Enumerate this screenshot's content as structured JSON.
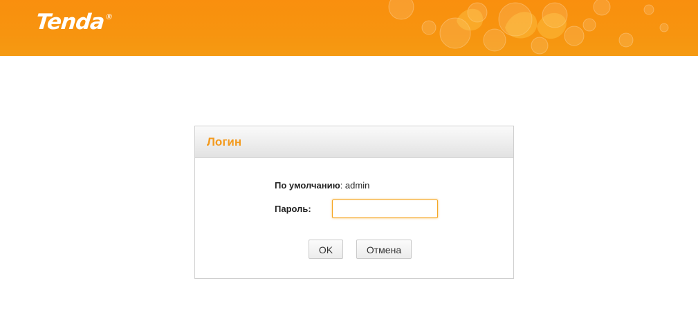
{
  "header": {
    "brand": "Tenda",
    "brand_mark": "®",
    "background_color": "#f7940f"
  },
  "login": {
    "title": "Логин",
    "default_label": "По умолчанию",
    "default_value": ": admin",
    "password_label": "Пароль:",
    "password_value": "",
    "ok_label": "OK",
    "cancel_label": "Отмена",
    "accent_color": "#f39a1e"
  }
}
